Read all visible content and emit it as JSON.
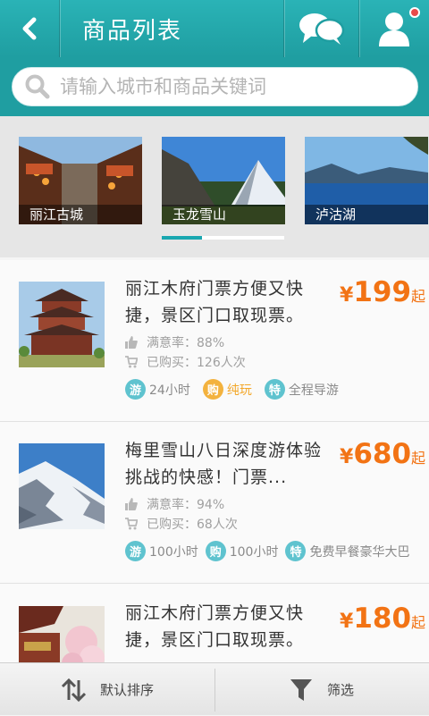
{
  "header": {
    "title": "商品列表",
    "back_icon": "chevron-left-icon",
    "message_icon": "chat-bubbles-icon",
    "user_icon": "user-icon",
    "color": "#22a8ab"
  },
  "search": {
    "placeholder": "请输入城市和商品关键词",
    "value": ""
  },
  "carousel": {
    "slides": [
      {
        "label": "丽江古城"
      },
      {
        "label": "玉龙雪山"
      },
      {
        "label": "泸沽湖"
      }
    ],
    "active_index": 1,
    "progress": 0.33
  },
  "products": [
    {
      "title": "丽江木府门票方便又快捷，景区门口取现票。",
      "price_symbol": "¥",
      "price": "199",
      "price_unit": "起",
      "satisfaction": "满意率：88%",
      "purchased": "已购买：126人次",
      "tags": [
        {
          "badge": "游",
          "text": "24小时",
          "color": "#5fc3cf"
        },
        {
          "badge": "购",
          "text": "纯玩",
          "color": "#f3b23e"
        },
        {
          "badge": "特",
          "text": "全程导游",
          "color": "#5fc3cf"
        }
      ]
    },
    {
      "title": "梅里雪山八日深度游体验挑战的快感！门票...",
      "price_symbol": "¥",
      "price": "680",
      "price_unit": "起",
      "satisfaction": "满意率：94%",
      "purchased": "已购买：68人次",
      "tags": [
        {
          "badge": "游",
          "text": "100小时",
          "color": "#5fc3cf"
        },
        {
          "badge": "购",
          "text": "100小时",
          "color": "#5fc3cf"
        },
        {
          "badge": "特",
          "text": "免费早餐豪华大巴",
          "color": "#5fc3cf"
        }
      ]
    },
    {
      "title": "丽江木府门票方便又快捷，景区门口取现票。",
      "price_symbol": "¥",
      "price": "180",
      "price_unit": "起"
    }
  ],
  "bottom_bar": {
    "sort_label": "默认排序",
    "filter_label": "筛选",
    "sort_icon": "sort-arrows-icon",
    "filter_icon": "filter-funnel-icon"
  }
}
